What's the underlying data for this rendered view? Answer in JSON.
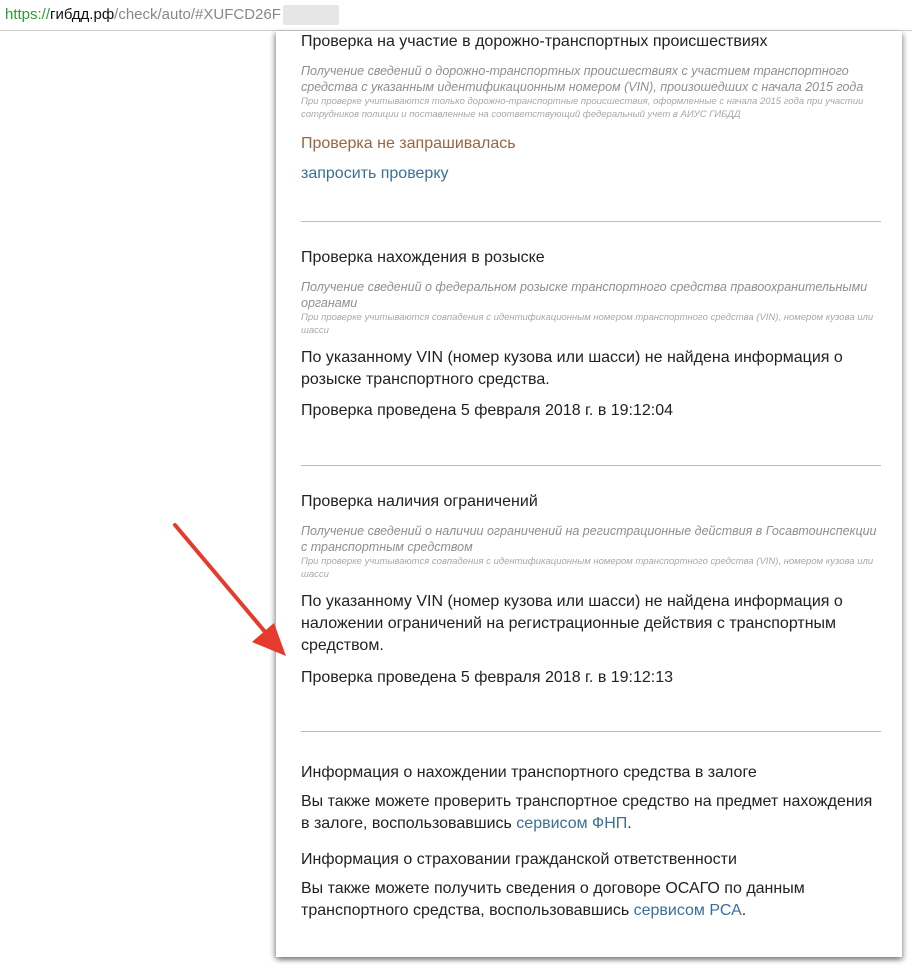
{
  "browser": {
    "url_protocol": "https://",
    "url_host": "гибдд.рф",
    "url_path": "/check/auto/#XUFCD26F"
  },
  "sections": {
    "dtp": {
      "title": "Проверка на участие в дорожно-транспортных происшествиях",
      "desc": "Получение сведений о дорожно-транспортных происшествиях с участием транспортного средства с указанным идентификационным номером (VIN), произошедших с начала 2015 года",
      "note": "При проверке учитываются только дорожно-транспортные происшествия, оформленные с начала 2015 года при участии сотрудников полиции и поставленные на соответствующий федеральный учет в АИУС ГИБДД",
      "status": "Проверка не запрашивалась",
      "request_link": "запросить проверку"
    },
    "wanted": {
      "title": "Проверка нахождения в розыске",
      "desc": "Получение сведений о федеральном розыске транспортного средства правоохранительными органами",
      "note": "При проверке учитываются совпадения с идентификационным номером транспортного средства (VIN), номером кузова или шасси",
      "result": "По указанному VIN (номер кузова или шасси) не найдена информация о розыске транспортного средства.",
      "checked": "Проверка проведена 5 февраля 2018 г. в 19:12:04"
    },
    "restrictions": {
      "title": "Проверка наличия ограничений",
      "desc": "Получение сведений о наличии ограничений на регистрационные действия в Госавтоинспекции с транспортным средством",
      "note": "При проверке учитываются совпадения с идентификационным номером транспортного средства (VIN), номером кузова или шасси",
      "result": "По указанному VIN (номер кузова или шасси) не найдена информация о наложении ограничений на регистрационные действия с транспортным средством.",
      "checked": "Проверка проведена 5 февраля 2018 г. в 19:12:13"
    },
    "pledge": {
      "title": "Информация о нахождении транспортного средства в залоге",
      "text": "Вы также можете проверить транспортное средство на предмет нахождения в залоге, воспользовавшись ",
      "link": "сервисом ФНП",
      "after": "."
    },
    "insurance": {
      "title": "Информация о страховании гражданской ответственности",
      "text": "Вы также можете получить сведения о договоре ОСАГО по данным транспортного средства, воспользовавшись ",
      "link": "сервисом РСА",
      "after": "."
    }
  },
  "colors": {
    "arrow": "#e53a2c",
    "link": "#3a6f9c",
    "status": "#9a6543",
    "url_protocol": "#2e9a3a"
  }
}
